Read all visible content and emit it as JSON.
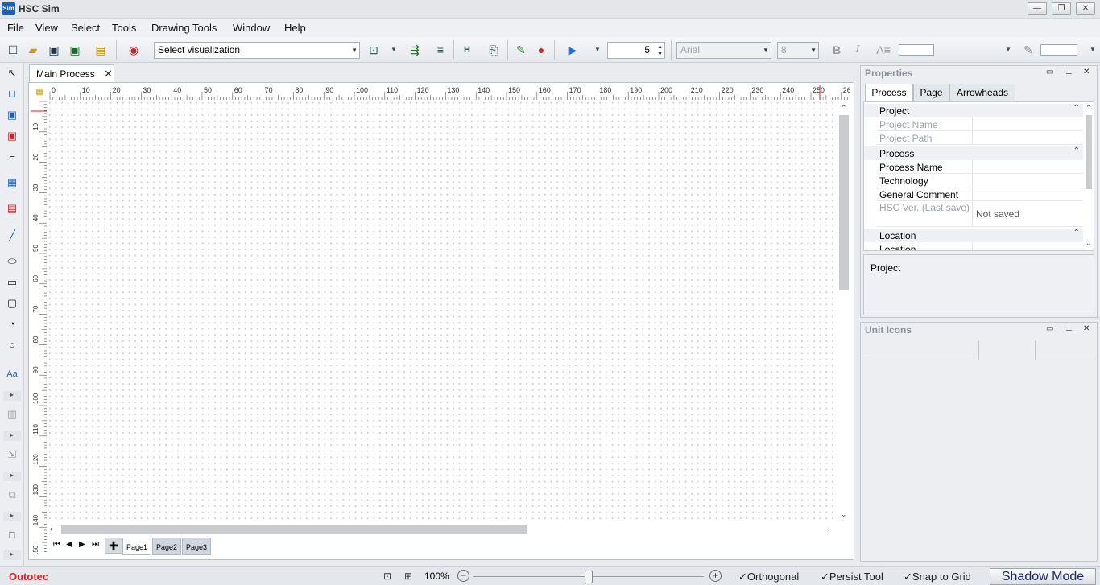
{
  "window": {
    "title": "HSC Sim",
    "icon_label": "Sim"
  },
  "menu": [
    "File",
    "View",
    "Select",
    "Tools",
    "Drawing Tools",
    "Window",
    "Help"
  ],
  "toolbar": {
    "visualization_combo": "Select visualization",
    "step_value": "5",
    "font_combo": "Arial",
    "font_size_combo": "8",
    "bold_label": "B",
    "italic_label": "I"
  },
  "document": {
    "tab_label": "Main Process",
    "ruler_top_labels": [
      "0",
      "10",
      "20",
      "30",
      "40",
      "50",
      "60",
      "70",
      "80",
      "90",
      "100",
      "110",
      "120",
      "130",
      "140",
      "150",
      "160",
      "170",
      "180",
      "190",
      "200",
      "210",
      "220",
      "230",
      "240",
      "250",
      "26"
    ],
    "ruler_left_labels": [
      "10",
      "20",
      "30",
      "40",
      "50",
      "60",
      "70",
      "80",
      "90",
      "100",
      "110",
      "120",
      "130",
      "140",
      "150"
    ],
    "pages": [
      "Page1",
      "Page2",
      "Page3"
    ],
    "active_page": "Page1"
  },
  "properties": {
    "title": "Properties",
    "tabs": [
      "Process",
      "Page",
      "Arrowheads"
    ],
    "active_tab": "Process",
    "categories": [
      {
        "label": "Project",
        "rows": [
          {
            "name": "Project Name",
            "value": "",
            "dim": true
          },
          {
            "name": "Project Path",
            "value": "",
            "dim": true
          }
        ]
      },
      {
        "label": "Process",
        "rows": [
          {
            "name": "Process Name",
            "value": "",
            "dim": false
          },
          {
            "name": "Technology",
            "value": "",
            "dim": false
          },
          {
            "name": "General Comment",
            "value": "",
            "dim": false
          },
          {
            "name": "HSC Ver. (Last save)",
            "value": "Not saved",
            "dim": true
          }
        ]
      },
      {
        "label": "Location",
        "rows": [
          {
            "name": "Location",
            "value": "",
            "dim": false
          }
        ]
      }
    ],
    "description_title": "Project"
  },
  "unit_icons": {
    "title": "Unit Icons"
  },
  "status": {
    "brand": "Outotec",
    "zoom": "100%",
    "zoom_level": 0.5,
    "orthogonal": "Orthogonal",
    "persist_tool": "Persist Tool",
    "snap_to_grid": "Snap to Grid",
    "shadow_mode": "Shadow Mode"
  },
  "colors": {
    "brand": "#d8232a",
    "canvas": "#ffffff",
    "accent_blue": "#1f5fb0"
  }
}
